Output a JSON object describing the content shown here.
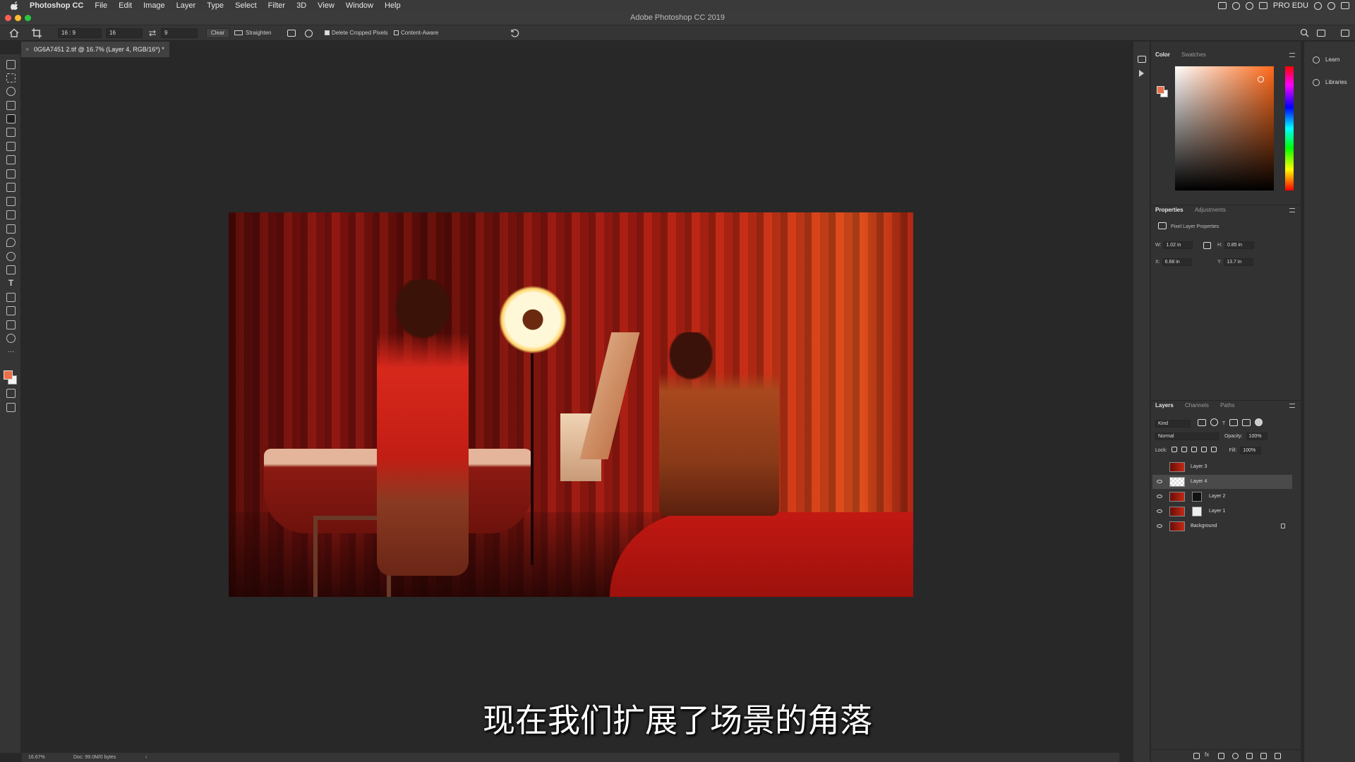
{
  "menubar": {
    "app": "Photoshop CC",
    "items": [
      "File",
      "Edit",
      "Image",
      "Layer",
      "Type",
      "Select",
      "Filter",
      "3D",
      "View",
      "Window",
      "Help"
    ],
    "right_label": "PRO EDU"
  },
  "window": {
    "title": "Adobe Photoshop CC 2019"
  },
  "options": {
    "ratio": "16 : 9",
    "width_value": "16",
    "height_value": "9",
    "clear_label": "Clear",
    "straighten_label": "Straighten",
    "delete_cropped_label": "Delete Cropped Pixels",
    "content_aware_label": "Content-Aware"
  },
  "document": {
    "tab_title": "0G6A7451 2.tif @ 16.7% (Layer 4, RGB/16*) *"
  },
  "subtitle": "现在我们扩展了场景的角落",
  "statusbar": {
    "zoom": "16.67%",
    "doc_info": "Doc: 99.0M/0 bytes"
  },
  "dock": {
    "learn": "Learn",
    "libraries": "Libraries"
  },
  "color_panel": {
    "tabs": [
      "Color",
      "Swatches"
    ],
    "foreground": "#e9704a",
    "background": "#ffffff"
  },
  "properties_panel": {
    "tabs": [
      "Properties",
      "Adjustments"
    ],
    "heading": "Pixel Layer Properties",
    "w_label": "W:",
    "w_value": "1.02 in",
    "h_label": "H:",
    "h_value": "0.85 in",
    "x_label": "X:",
    "x_value": "6.68 in",
    "y_label": "Y:",
    "y_value": "13.7 in"
  },
  "layers_panel": {
    "tabs": [
      "Layers",
      "Channels",
      "Paths"
    ],
    "filter_kind": "Kind",
    "blend_mode": "Normal",
    "opacity_label": "Opacity:",
    "opacity_value": "100%",
    "lock_label": "Lock:",
    "fill_label": "Fill:",
    "fill_value": "100%",
    "layers": [
      {
        "name": "Layer 3",
        "visible": false,
        "selected": false
      },
      {
        "name": "Layer 4",
        "visible": true,
        "selected": true
      },
      {
        "name": "Layer 2",
        "visible": true,
        "selected": false
      },
      {
        "name": "Layer 1",
        "visible": true,
        "selected": false
      },
      {
        "name": "Background",
        "visible": true,
        "selected": false
      }
    ]
  }
}
